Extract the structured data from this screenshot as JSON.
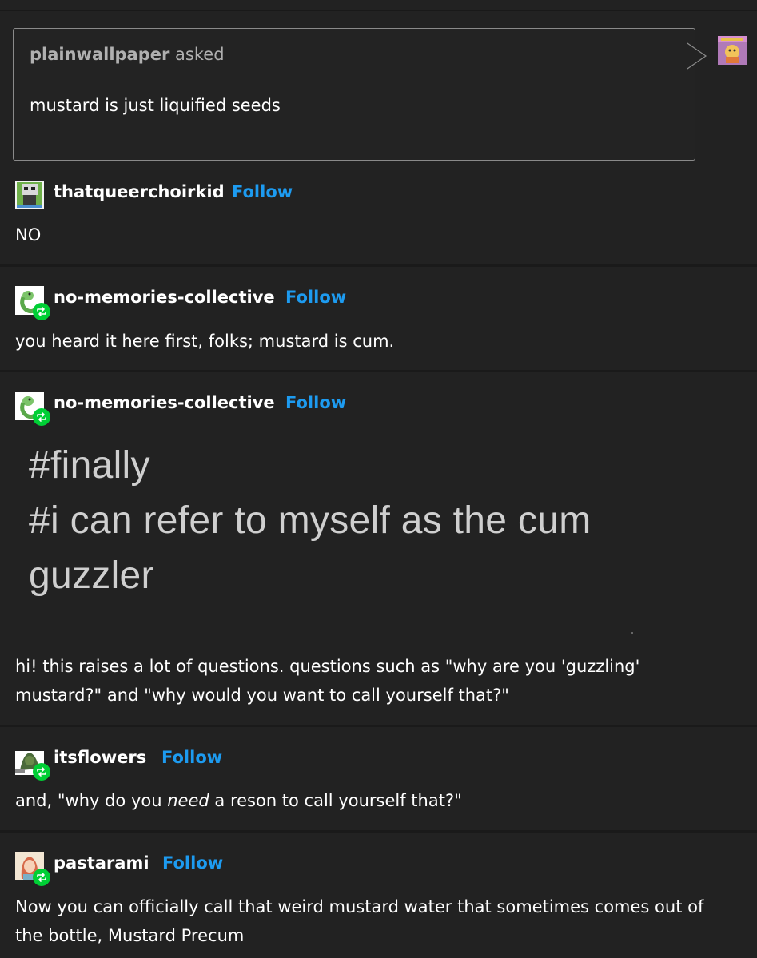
{
  "ask": {
    "asker": "plainwallpaper",
    "asked_label": "asked",
    "question": "mustard is just liquified seeds"
  },
  "posts": [
    {
      "username": "thatqueerchoirkid",
      "follow": "Follow",
      "text": "NO"
    },
    {
      "username": "no-memories-collective",
      "follow": "Follow",
      "text": "you heard it here first, folks; mustard is cum."
    },
    {
      "username": "no-memories-collective",
      "follow": "Follow",
      "tags": [
        "#finally",
        "#i can refer to myself as the cum",
        "guzzler"
      ],
      "text_line1": "hi! this raises a lot of questions. questions such as \"why are you 'guzzling'",
      "text_line2": "mustard?\" and \"why would you want to call yourself that?\""
    },
    {
      "username": "itsflowers",
      "follow": "Follow",
      "text_pre": "and, \"why do you ",
      "text_em": "need",
      "text_post": " a reson to call yourself that?\""
    },
    {
      "username": "pastarami",
      "follow": "Follow",
      "text_line1": "Now you can officially call that weird mustard water that sometimes comes out of",
      "text_line2": "the bottle, Mustard Precum"
    }
  ],
  "colors": {
    "background": "#222222",
    "follow": "#1d9bf0",
    "reblog_badge": "#00cf35"
  },
  "icons": [
    "avatar",
    "reblog-icon"
  ]
}
